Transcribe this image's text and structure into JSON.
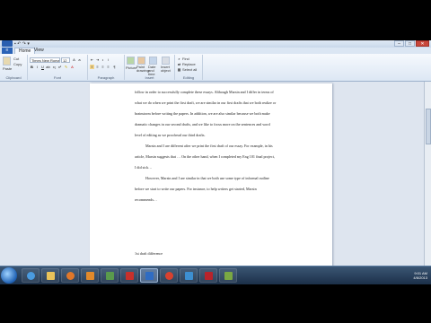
{
  "tabs": {
    "file": "File",
    "home": "View"
  },
  "ribbon": {
    "paste": "Paste",
    "cut": "Cut",
    "copy": "Copy",
    "clipboard_group": "Clipboard",
    "font_name": "Times New Roman",
    "font_size": "12",
    "font_group": "Font",
    "paragraph_group": "Paragraph",
    "picture": "Picture",
    "paint_drawing": "Paint drawing",
    "date_time": "Date and time",
    "insert_object": "Insert object",
    "insert_group": "Insert",
    "find": "Find",
    "replace": "Replace",
    "select_all": "Select all",
    "editing_group": "Editing"
  },
  "document": {
    "lines": [
      "follow in order to successfully complete these essays. Although Marsin and I differ in terms of",
      "what we do when we print the first draft, we are similar in our first drafts that we both realize or",
      "brainstorm before writing the papers. In addition, we are also similar because we both make",
      "dramatic changes in our second drafts, and we like to focus more on the sentences and word",
      "level of editing as we proofread our third drafts.",
      "Marsin and I are different after we print the first draft of our essay. For example, in his",
      "article, Marsin suggests that … On the other hand, when I completed my Eng 101 final project,",
      "I did sick…",
      "However, Marsin and I are similar in that we both use some type of informal outline",
      "before we start to write our papers. For instance, to help writers get started, Marsin",
      "recommends…",
      "1st draft difference"
    ]
  },
  "status": {
    "zoom": "100%"
  },
  "taskbar": {
    "time": "9:01 AM",
    "date": "4/6/2013"
  }
}
